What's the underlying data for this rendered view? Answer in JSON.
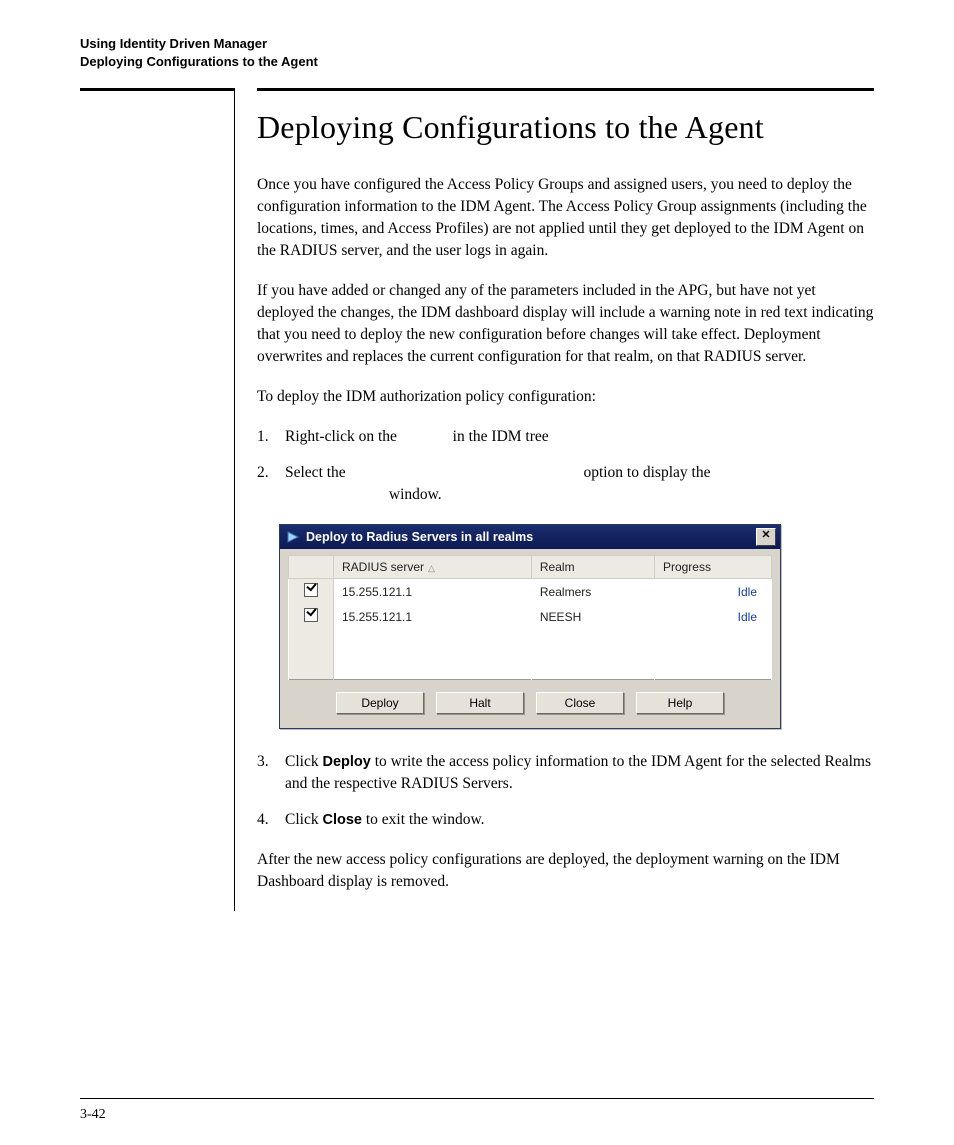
{
  "header": {
    "line1": "Using Identity Driven Manager",
    "line2": "Deploying Configurations to the Agent"
  },
  "title": "Deploying Configurations to the Agent",
  "para1": "Once you have configured the Access Policy Groups and assigned users, you need to deploy the configuration information to the IDM Agent. The Access Policy Group assignments (including the locations, times, and Access Profiles) are not applied until they get deployed to the IDM Agent on the RADIUS server, and the user logs in again.",
  "para2": "If you have added or changed any of the parameters included in the APG, but have not yet deployed the changes, the IDM dashboard display will include a warning note in red text indicating that you need to deploy the new configuration before changes will take effect. Deployment overwrites and replaces the current configuration for that realm, on that RADIUS server.",
  "lead": "To deploy the IDM authorization policy configuration:",
  "steps": {
    "s1_pre": "Right-click on the ",
    "s1_post": " in the IDM tree",
    "s2_pre": "Select the ",
    "s2_mid": " option to display the ",
    "s2_post": " window.",
    "s3_pre": "Click ",
    "s3_bold": "Deploy",
    "s3_post": " to write the access policy information to the IDM Agent for the selected Realms and the respective RADIUS Servers.",
    "s4_pre": "Click ",
    "s4_bold": "Close",
    "s4_post": " to exit the window."
  },
  "closing": "After the new access policy configurations are deployed, the deployment warning on the IDM Dashboard display is removed.",
  "dialog": {
    "title": "Deploy to Radius Servers in all realms",
    "close_glyph": "✕",
    "columns": {
      "server": "RADIUS server",
      "realm": "Realm",
      "progress": "Progress"
    },
    "rows": [
      {
        "checked": true,
        "server": "15.255.121.1",
        "realm": "Realmers",
        "progress": "Idle"
      },
      {
        "checked": true,
        "server": "15.255.121.1",
        "realm": "NEESH",
        "progress": "Idle"
      }
    ],
    "buttons": {
      "deploy": "Deploy",
      "halt": "Halt",
      "close": "Close",
      "help": "Help"
    }
  },
  "page_number": "3-42"
}
